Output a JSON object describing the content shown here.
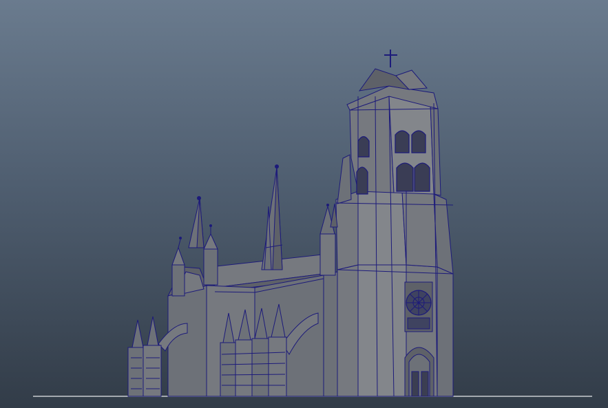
{
  "scene": {
    "background_top": "#6a7b8e",
    "background_bottom": "#323c48",
    "mesh_face": "#6d7178",
    "wireframe": "#1c1a7a"
  }
}
